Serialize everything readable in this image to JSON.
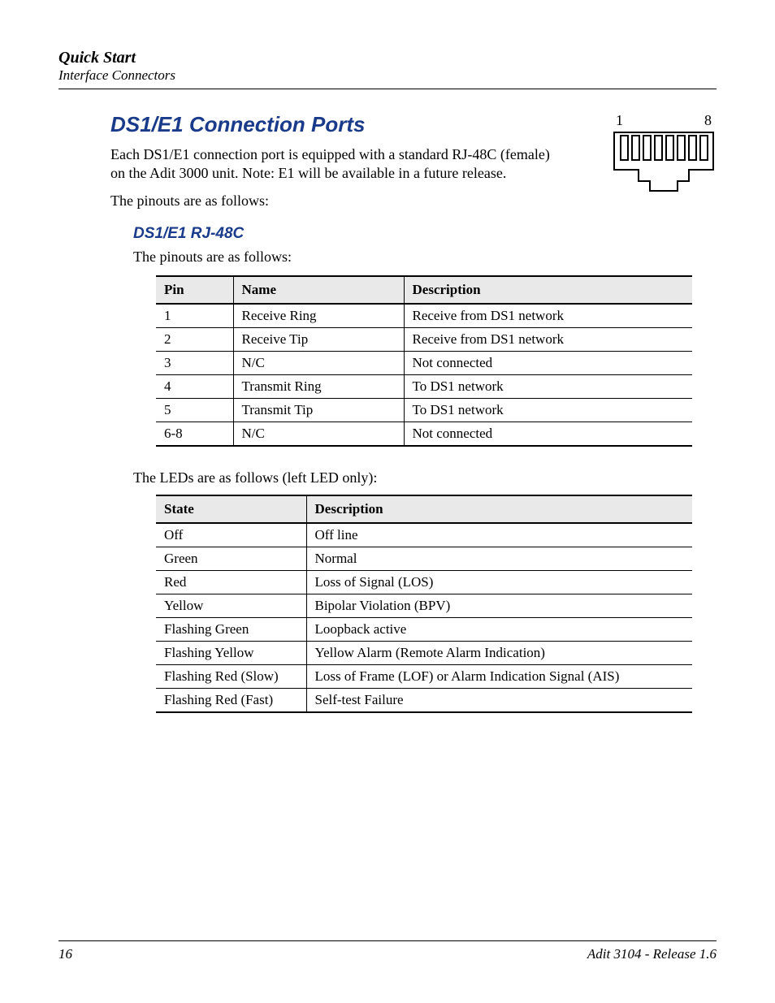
{
  "header": {
    "chapter": "Quick Start",
    "section": "Interface Connectors"
  },
  "main": {
    "title": "DS1/E1 Connection Ports",
    "intro": "Each DS1/E1 connection port is equipped with a standard RJ-48C (female) on the Adit 3000 unit. Note: E1 will be available in a future release.",
    "pinouts_lead": "The pinouts are as follows:",
    "connector": {
      "left_pin": "1",
      "right_pin": "8"
    },
    "subsection": {
      "title": "DS1/E1 RJ-48C",
      "lead": "The pinouts are as follows:"
    },
    "pin_table": {
      "headers": [
        "Pin",
        "Name",
        "Description"
      ],
      "rows": [
        [
          "1",
          "Receive Ring",
          "Receive from DS1 network"
        ],
        [
          "2",
          "Receive Tip",
          "Receive from DS1 network"
        ],
        [
          "3",
          "N/C",
          "Not connected"
        ],
        [
          "4",
          "Transmit Ring",
          "To DS1 network"
        ],
        [
          "5",
          "Transmit Tip",
          "To DS1 network"
        ],
        [
          "6-8",
          "N/C",
          "Not connected"
        ]
      ]
    },
    "led_lead": "The LEDs are as follows (left LED only):",
    "led_table": {
      "headers": [
        "State",
        "Description"
      ],
      "rows": [
        [
          "Off",
          "Off line"
        ],
        [
          "Green",
          "Normal"
        ],
        [
          "Red",
          "Loss of Signal (LOS)"
        ],
        [
          "Yellow",
          "Bipolar Violation (BPV)"
        ],
        [
          "Flashing Green",
          "Loopback active"
        ],
        [
          "Flashing Yellow",
          "Yellow Alarm (Remote Alarm Indication)"
        ],
        [
          "Flashing Red (Slow)",
          "Loss of Frame (LOF) or Alarm Indication Signal (AIS)"
        ],
        [
          "Flashing Red (Fast)",
          "Self-test Failure"
        ]
      ]
    }
  },
  "footer": {
    "page": "16",
    "doc": "Adit 3104  - Release 1.6"
  }
}
